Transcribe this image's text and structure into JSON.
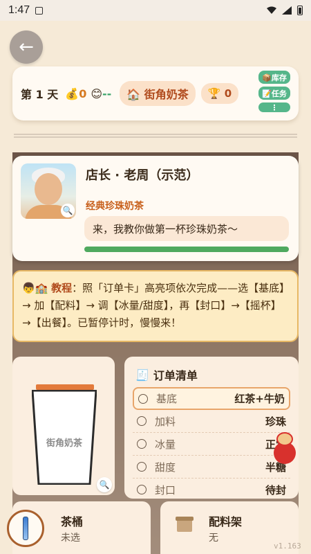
{
  "status_bar": {
    "time": "1:47"
  },
  "header": {
    "day_label": "第 1 天",
    "money_icon": "💰",
    "money": "0",
    "mood_icon": "😊",
    "mood_value": "--",
    "shop_name": "🏠 街角奶茶",
    "trophy_icon": "🏆",
    "trophy_count": "0",
    "side_buttons": [
      "📦库存",
      "📝任务",
      "⋮"
    ]
  },
  "npc": {
    "name": "店长 · 老周（示范）",
    "order_name": "经典珍珠奶茶",
    "speech": "来，我教你做第一杯珍珠奶茶～",
    "progress": 1.0
  },
  "tutorial": {
    "icon": "👦🏫",
    "tag": "教程",
    "text": "：照「订单卡」高亮项依次完成——选【基底】→ 加【配料】→ 调【冰量/甜度】，再【封口】→【摇杯】→【出餐】。已暂停计时，慢慢来！"
  },
  "cup": {
    "label": "街角奶茶"
  },
  "order_list": {
    "title": "订单清单",
    "rows": [
      {
        "label": "基底",
        "value": "红茶+牛奶",
        "active": true
      },
      {
        "label": "加料",
        "value": "珍珠"
      },
      {
        "label": "冰量",
        "value": "正常"
      },
      {
        "label": "甜度",
        "value": "半糖"
      },
      {
        "label": "封口",
        "value": "待封"
      }
    ]
  },
  "bottom": {
    "bucket_label": "茶桶",
    "bucket_value": "未选",
    "shelf_label": "配料架",
    "shelf_value": "无"
  },
  "version": "v1.163"
}
